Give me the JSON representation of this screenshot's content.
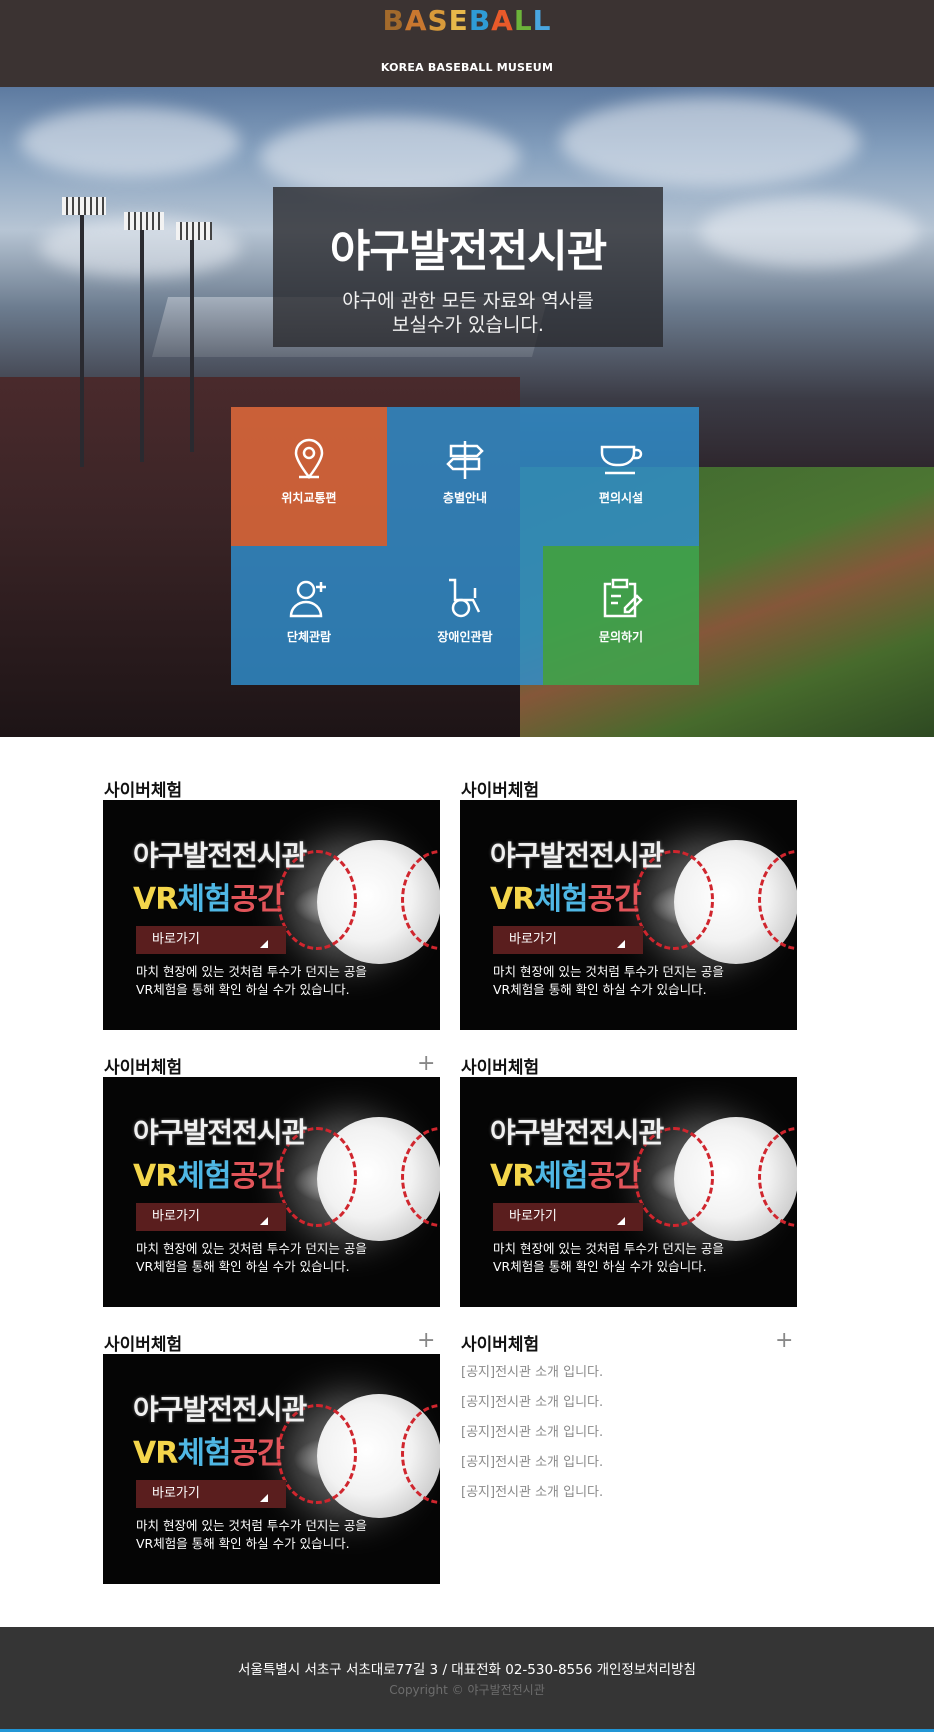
{
  "header": {
    "logo_letters": [
      "B",
      "A",
      "S",
      "E",
      "B",
      "A",
      "L",
      "L"
    ],
    "logo_colors": [
      "#a26a2c",
      "#c9772f",
      "#d89a3a",
      "#e8b84a",
      "#2f9bd5",
      "#e85a2a",
      "#6cb43a",
      "#49a6e0"
    ],
    "logo_sub": "KOREA BASEBALL MUSEUM"
  },
  "hero": {
    "title": "야구발전전시관",
    "desc_line1": "야구에 관한 모든 자료와 역사를",
    "desc_line2": "보실수가 있습니다."
  },
  "quick_links": [
    {
      "label": "위치교통편",
      "icon": "location-pin-icon",
      "color": "#d8663a"
    },
    {
      "label": "층별안내",
      "icon": "signpost-icon",
      "color": "#2f8fce"
    },
    {
      "label": "편의시설",
      "icon": "coffee-cup-icon",
      "color": "#2f8fce"
    },
    {
      "label": "단체관람",
      "icon": "add-person-icon",
      "color": "#2f8fce"
    },
    {
      "label": "장애인관람",
      "icon": "wheelchair-icon",
      "color": "#2f8fce"
    },
    {
      "label": "문의하기",
      "icon": "clipboard-edit-icon",
      "color": "#3fa34d"
    }
  ],
  "cards": [
    {
      "title": "사이버체험"
    },
    {
      "title": "사이버체험"
    },
    {
      "title": "사이버체험"
    },
    {
      "title": "사이버체험"
    },
    {
      "title": "사이버체험"
    }
  ],
  "banner": {
    "title1": "야구발전전시관",
    "title_vr": "VR",
    "title_che": "체험",
    "title_gong": "공간",
    "button": "바로가기",
    "desc_line1": "마치 현장에 있는 것처럼 투수가 던지는 공을",
    "desc_line2": "VR체험을 통해 확인 하실 수가 있습니다."
  },
  "plus_symbol": "+",
  "notice": {
    "title": "사이버체험",
    "items": [
      "[공지]전시관 소개 입니다.",
      "[공지]전시관 소개 입니다.",
      "[공지]전시관 소개 입니다.",
      "[공지]전시관 소개 입니다.",
      "[공지]전시관 소개 입니다."
    ]
  },
  "footer": {
    "address": "서울특별시 서초구 서초대로77길 3 / 대표전화 02-530-8556 개인정보처리방침",
    "copyright": "Copyright © 야구발전전시관"
  }
}
